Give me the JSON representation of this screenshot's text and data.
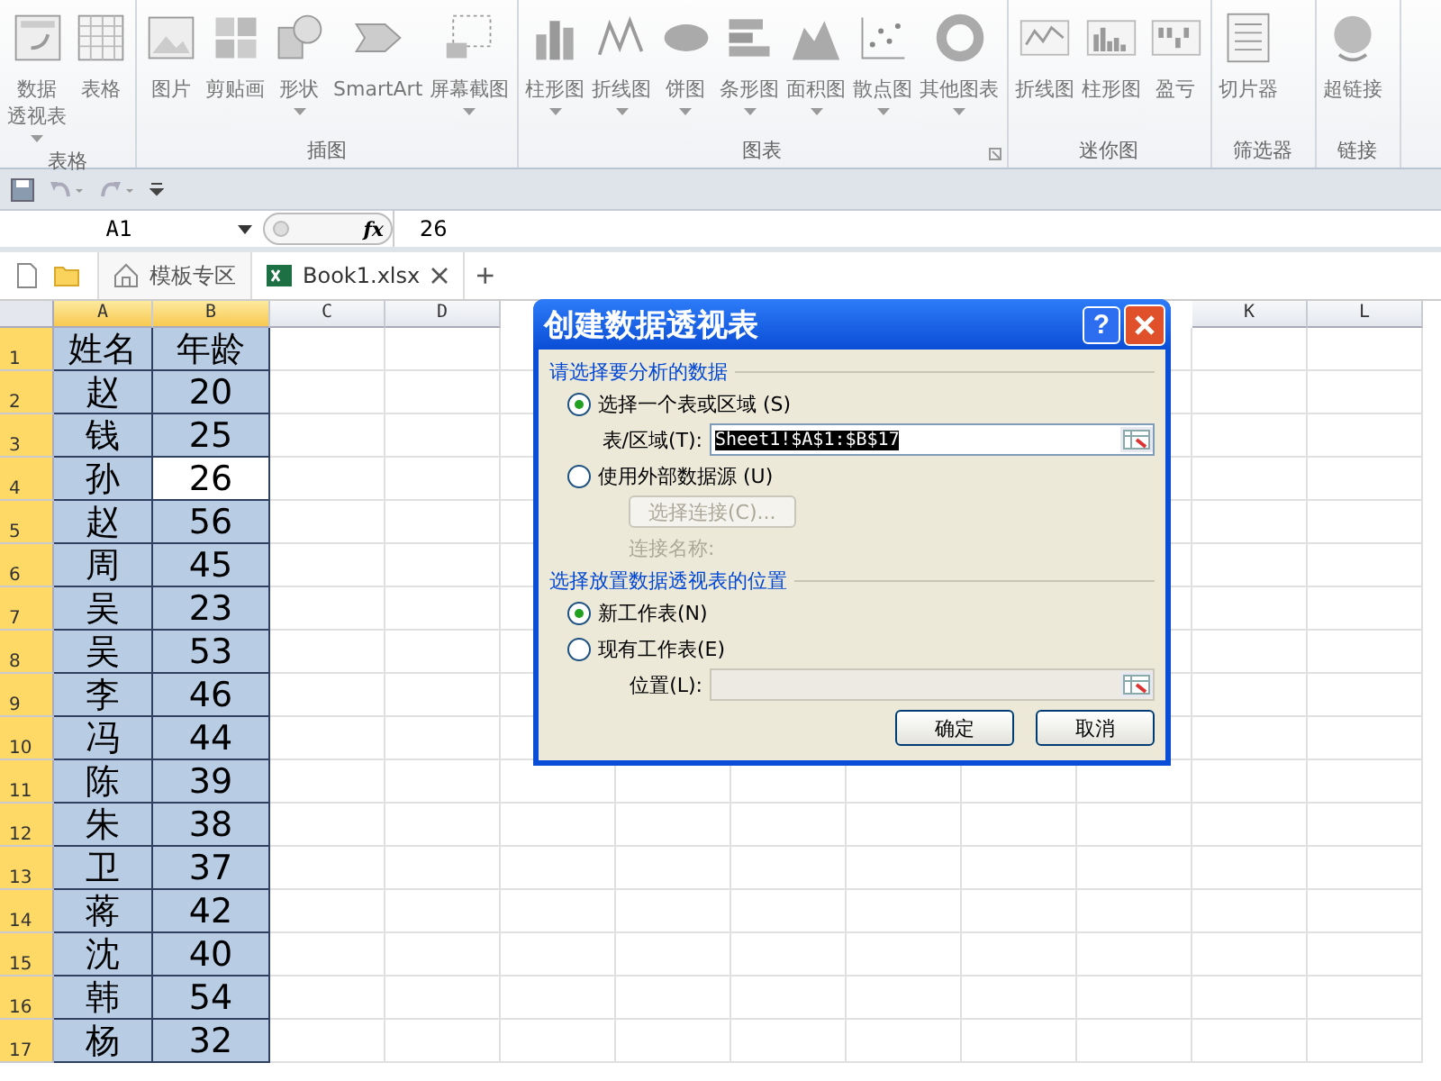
{
  "ribbon": {
    "groups": [
      {
        "label": "表格",
        "buttons": [
          {
            "lines": [
              "数据",
              "透视表"
            ],
            "dropdown": true
          },
          {
            "label": "表格",
            "dropdown": false
          }
        ]
      },
      {
        "label": "插图",
        "buttons": [
          {
            "label": "图片",
            "dropdown": false
          },
          {
            "label": "剪贴画",
            "dropdown": false
          },
          {
            "label": "形状",
            "dropdown": true
          },
          {
            "label": "SmartArt",
            "dropdown": false
          },
          {
            "label": "屏幕截图",
            "dropdown": true
          }
        ]
      },
      {
        "label": "图表",
        "launcher": true,
        "buttons": [
          {
            "label": "柱形图",
            "dropdown": true
          },
          {
            "label": "折线图",
            "dropdown": true
          },
          {
            "label": "饼图",
            "dropdown": true
          },
          {
            "label": "条形图",
            "dropdown": true
          },
          {
            "label": "面积图",
            "dropdown": true
          },
          {
            "label": "散点图",
            "dropdown": true
          },
          {
            "label": "其他图表",
            "dropdown": true
          }
        ]
      },
      {
        "label": "迷你图",
        "buttons": [
          {
            "label": "折线图",
            "dropdown": false
          },
          {
            "label": "柱形图",
            "dropdown": false
          },
          {
            "label": "盈亏",
            "dropdown": false
          }
        ]
      },
      {
        "label": "筛选器",
        "buttons": [
          {
            "label": "切片器",
            "dropdown": false
          }
        ]
      },
      {
        "label": "链接",
        "buttons": [
          {
            "label": "超链接",
            "dropdown": false
          }
        ]
      }
    ]
  },
  "formula_bar": {
    "name_box": "A1",
    "fx": "fx",
    "value": "26"
  },
  "tabs": [
    {
      "label": "模板专区",
      "selected": false,
      "closable": false
    },
    {
      "label": "Book1.xlsx",
      "selected": true,
      "closable": true
    }
  ],
  "new_tab": "+",
  "grid": {
    "columns": [
      {
        "label": "A",
        "selected": true
      },
      {
        "label": "B",
        "selected": true
      },
      {
        "label": "C",
        "selected": false
      },
      {
        "label": "D",
        "selected": false
      },
      {},
      {},
      {},
      {},
      {},
      {},
      {
        "label": "K",
        "selected": false
      },
      {
        "label": "L",
        "selected": false
      }
    ],
    "rows": [
      {
        "number": "1",
        "cells": [
          {
            "text": "姓名",
            "active": false
          },
          {
            "text": "年龄",
            "active": false
          }
        ]
      },
      {
        "number": "2",
        "cells": [
          {
            "text": "赵",
            "active": false
          },
          {
            "text": "20",
            "active": false
          }
        ]
      },
      {
        "number": "3",
        "cells": [
          {
            "text": "钱",
            "active": false
          },
          {
            "text": "25",
            "active": false
          }
        ]
      },
      {
        "number": "4",
        "cells": [
          {
            "text": "孙",
            "active": false
          },
          {
            "text": "26",
            "active": true
          }
        ]
      },
      {
        "number": "5",
        "cells": [
          {
            "text": "赵",
            "active": false
          },
          {
            "text": "56",
            "active": false
          }
        ]
      },
      {
        "number": "6",
        "cells": [
          {
            "text": "周",
            "active": false
          },
          {
            "text": "45",
            "active": false
          }
        ]
      },
      {
        "number": "7",
        "cells": [
          {
            "text": "吴",
            "active": false
          },
          {
            "text": "23",
            "active": false
          }
        ]
      },
      {
        "number": "8",
        "cells": [
          {
            "text": "吴",
            "active": false
          },
          {
            "text": "53",
            "active": false
          }
        ]
      },
      {
        "number": "9",
        "cells": [
          {
            "text": "李",
            "active": false
          },
          {
            "text": "46",
            "active": false
          }
        ]
      },
      {
        "number": "10",
        "cells": [
          {
            "text": "冯",
            "active": false
          },
          {
            "text": "44",
            "active": false
          }
        ]
      },
      {
        "number": "11",
        "cells": [
          {
            "text": "陈",
            "active": false
          },
          {
            "text": "39",
            "active": false
          }
        ]
      },
      {
        "number": "12",
        "cells": [
          {
            "text": "朱",
            "active": false
          },
          {
            "text": "38",
            "active": false
          }
        ]
      },
      {
        "number": "13",
        "cells": [
          {
            "text": "卫",
            "active": false
          },
          {
            "text": "37",
            "active": false
          }
        ]
      },
      {
        "number": "14",
        "cells": [
          {
            "text": "蒋",
            "active": false
          },
          {
            "text": "42",
            "active": false
          }
        ]
      },
      {
        "number": "15",
        "cells": [
          {
            "text": "沈",
            "active": false
          },
          {
            "text": "40",
            "active": false
          }
        ]
      },
      {
        "number": "16",
        "cells": [
          {
            "text": "韩",
            "active": false
          },
          {
            "text": "54",
            "active": false
          }
        ]
      },
      {
        "number": "17",
        "cells": [
          {
            "text": "杨",
            "active": false
          },
          {
            "text": "32",
            "active": false
          }
        ]
      }
    ]
  },
  "dialog": {
    "title": "创建数据透视表",
    "help": "?",
    "sections": [
      {
        "heading": "请选择要分析的数据",
        "items": [
          {
            "kind": "radio",
            "label": "选择一个表或区域 (S)",
            "selected": true
          },
          {
            "kind": "field",
            "label": "表/区域(T):",
            "value": "Sheet1!$A$1:$B$17",
            "disabled": false
          },
          {
            "kind": "radio",
            "label": "使用外部数据源 (U)",
            "selected": false
          },
          {
            "kind": "button",
            "label": "选择连接(C)...",
            "disabled": true
          },
          {
            "kind": "text",
            "label": "连接名称:",
            "disabled": true
          }
        ]
      },
      {
        "heading": "选择放置数据透视表的位置",
        "items": [
          {
            "kind": "radio",
            "label": "新工作表(N)",
            "selected": true
          },
          {
            "kind": "radio",
            "label": "现有工作表(E)",
            "selected": false
          },
          {
            "kind": "field",
            "label": "位置(L):",
            "disabled": true
          }
        ]
      }
    ],
    "buttons": [
      "确定",
      "取消"
    ]
  }
}
